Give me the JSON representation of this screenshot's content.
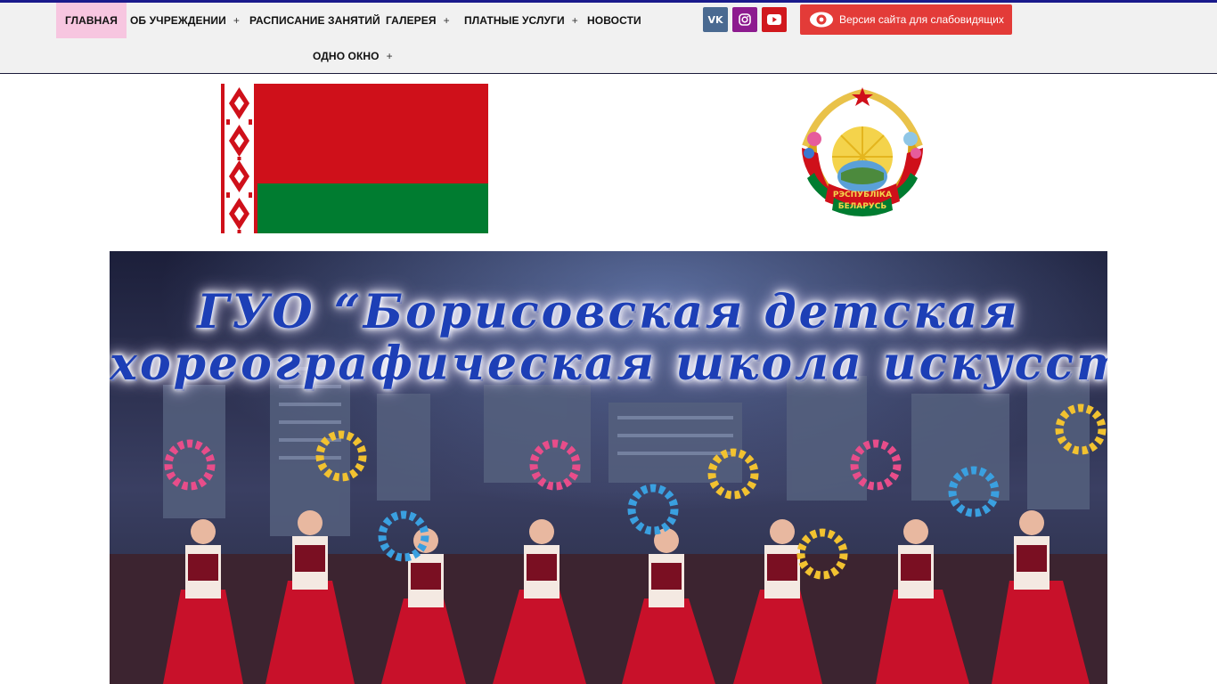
{
  "nav": {
    "items": [
      {
        "label": "ГЛАВНАЯ",
        "has_submenu": false,
        "active": true
      },
      {
        "label": "ОБ УЧРЕЖДЕНИИ",
        "has_submenu": true
      },
      {
        "label": "РАСПИСАНИЕ ЗАНЯТИЙ",
        "has_submenu": false
      },
      {
        "label": "ГАЛЕРЕЯ",
        "has_submenu": true
      },
      {
        "label": "ПЛАТНЫЕ УСЛУГИ",
        "has_submenu": true
      },
      {
        "label": "НОВОСТИ",
        "has_submenu": false
      },
      {
        "label": "ОДНО ОКНО",
        "has_submenu": true
      }
    ],
    "submenu_marker": "+",
    "active_bg": "#f7c6e0"
  },
  "social": {
    "vk": {
      "label": "VK",
      "icon": "vk-icon",
      "color": "#4a6a91"
    },
    "instagram": {
      "icon": "instagram-icon",
      "color": "#8d1b8f"
    },
    "youtube": {
      "icon": "youtube-icon",
      "color": "#d1181d"
    }
  },
  "accessibility": {
    "label": "Версия сайта для слабовидящих",
    "icon": "eye-icon",
    "color": "#e33b38"
  },
  "emblem": {
    "line1": "РЭСПУБЛІКА",
    "line2": "БЕЛАРУСЬ"
  },
  "banner": {
    "title_line1": "ГУО “Борисовская детская",
    "title_line2": "хореографическая школа искусств”"
  }
}
